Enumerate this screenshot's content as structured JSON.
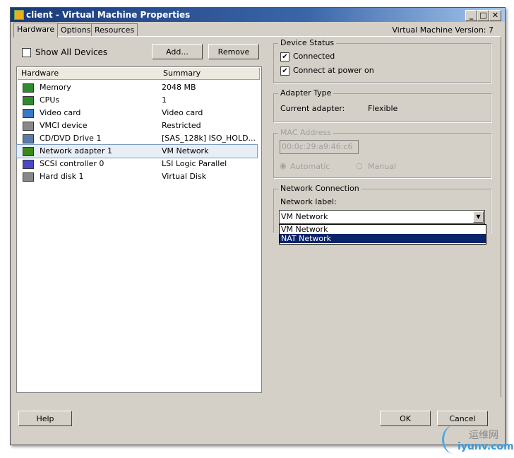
{
  "window": {
    "title": "client - Virtual Machine Properties",
    "vm_version": "Virtual Machine Version: 7"
  },
  "tabs": [
    {
      "label": "Hardware"
    },
    {
      "label": "Options"
    },
    {
      "label": "Resources"
    }
  ],
  "hardware": {
    "show_all_devices": "Show All Devices",
    "add": "Add...",
    "remove": "Remove",
    "columns": [
      "Hardware",
      "Summary"
    ],
    "rows": [
      {
        "name": "Memory",
        "summary": "2048 MB",
        "icon": "memory-icon",
        "color": "#2e8b2e"
      },
      {
        "name": "CPUs",
        "summary": "1",
        "icon": "cpu-icon",
        "color": "#2e8b2e"
      },
      {
        "name": "Video card",
        "summary": "Video card",
        "icon": "monitor-icon",
        "color": "#3a78c8"
      },
      {
        "name": "VMCI device",
        "summary": "Restricted",
        "icon": "device-icon",
        "color": "#888888"
      },
      {
        "name": "CD/DVD Drive 1",
        "summary": "[SAS_128k] ISO_HOLD...",
        "icon": "cd-drive-icon",
        "color": "#5a7aa8"
      },
      {
        "name": "Network adapter 1",
        "summary": "VM Network",
        "icon": "network-adapter-icon",
        "color": "#3a8a1a"
      },
      {
        "name": "SCSI controller 0",
        "summary": "LSI Logic Parallel",
        "icon": "scsi-icon",
        "color": "#4a4ac8"
      },
      {
        "name": "Hard disk 1",
        "summary": "Virtual Disk",
        "icon": "hard-disk-icon",
        "color": "#888888"
      }
    ]
  },
  "device_status": {
    "title": "Device Status",
    "connected": "Connected",
    "connect_power_on": "Connect at power on"
  },
  "adapter_type": {
    "title": "Adapter Type",
    "label": "Current adapter:",
    "value": "Flexible"
  },
  "mac": {
    "title": "MAC Address",
    "value": "00:0c:29:a9:46:c6",
    "automatic": "Automatic",
    "manual": "Manual"
  },
  "network": {
    "title": "Network Connection",
    "label": "Network label:",
    "selected": "VM Network",
    "options": [
      "VM Network",
      "NAT Network"
    ]
  },
  "footer": {
    "help": "Help",
    "ok": "OK",
    "cancel": "Cancel"
  },
  "watermark": {
    "text1": "运维网",
    "text2": "iyunv.com"
  }
}
